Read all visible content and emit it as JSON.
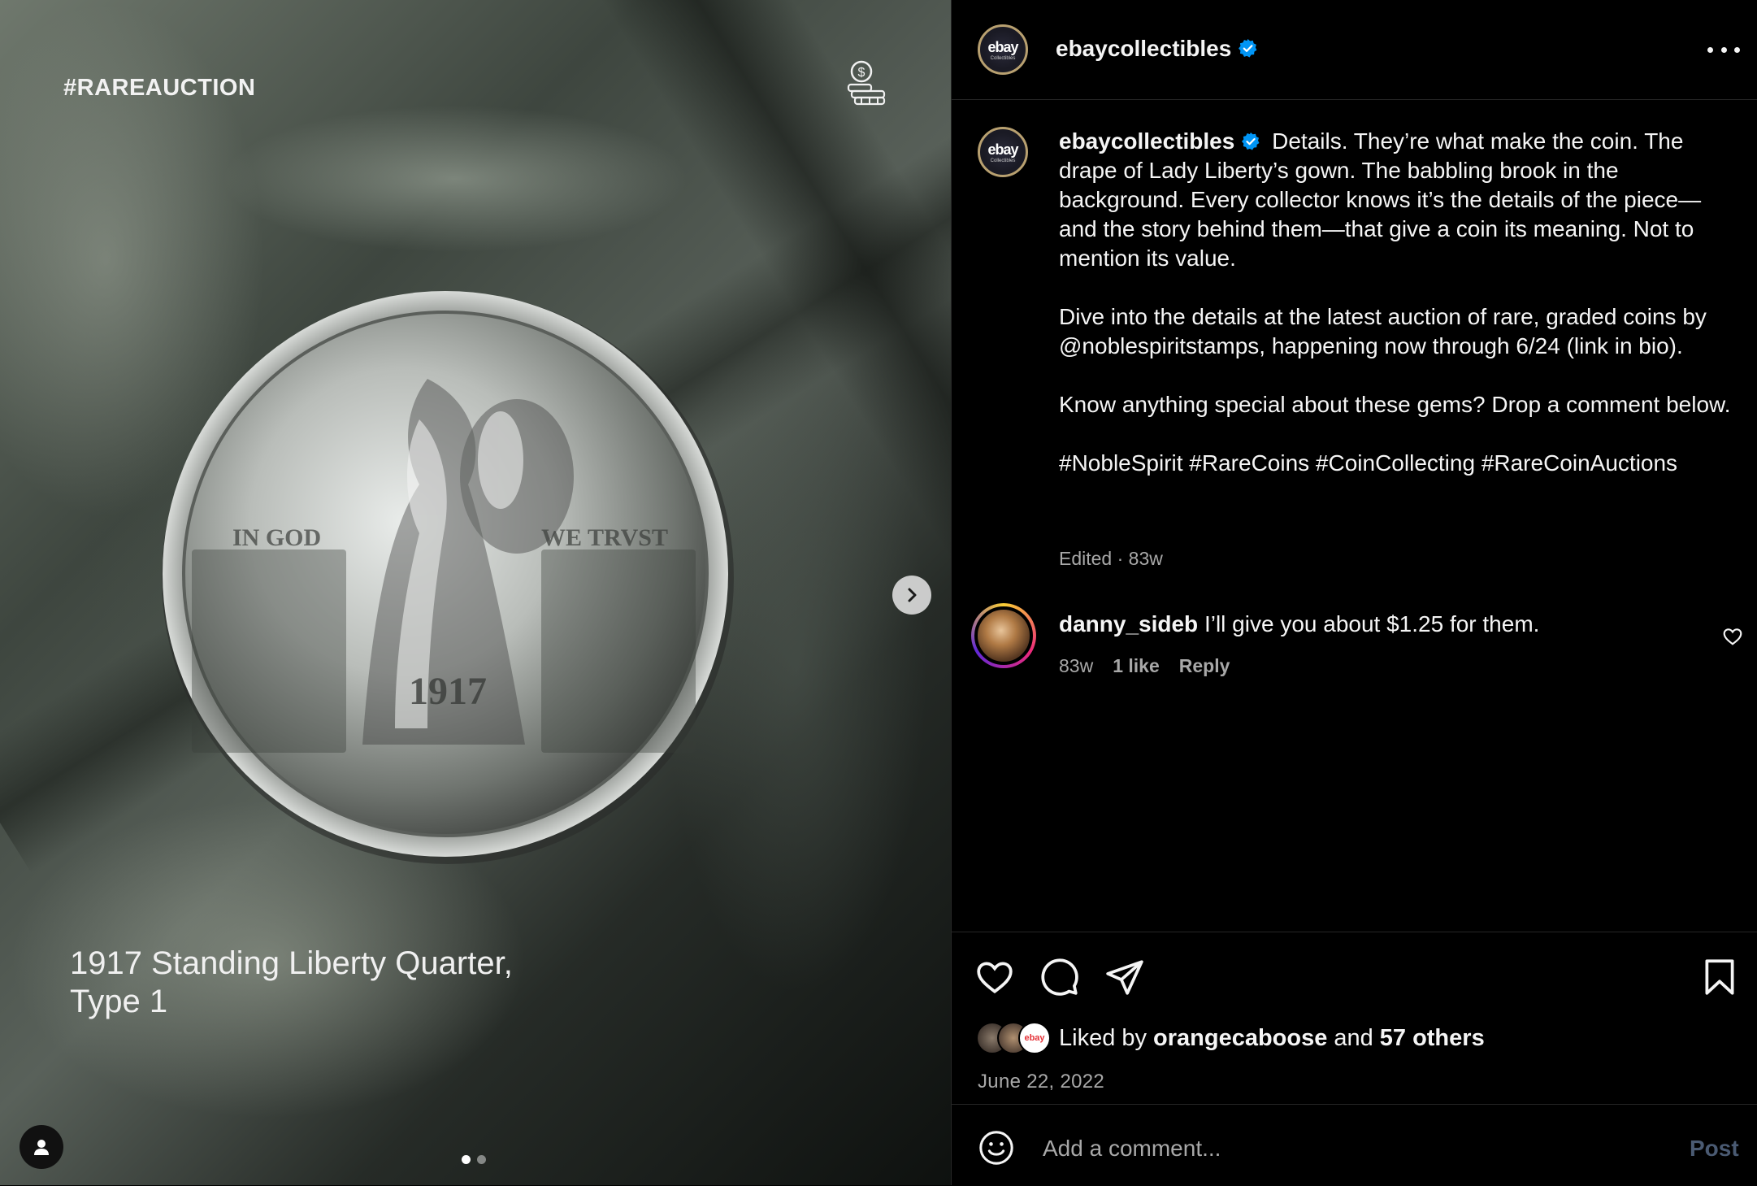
{
  "post_media": {
    "hashtag_overlay": "#RAREAUCTION",
    "caption_overlay": "1917 Standing Liberty Quarter, Type 1",
    "icons": [
      "coins-icon",
      "chevron-right-icon",
      "user-tag-icon"
    ],
    "carousel": {
      "total": 2,
      "current": 1
    }
  },
  "header": {
    "username": "ebaycollectibles",
    "verified": true,
    "avatar_logo": "ebay",
    "avatar_subtext": "Collectibles"
  },
  "caption": {
    "username": "ebaycollectibles",
    "para1": "Details. They’re what make the coin. The drape of Lady Liberty’s gown. The babbling brook in the background. Every collector knows it’s the details of the piece—and the story behind them—that give a coin its meaning. Not to mention its value.",
    "para2": "Dive into the details at the latest auction of rare, graded coins by @noblespiritstamps, happening now through 6/24 (link in bio).",
    "para3": "Know anything special about these gems? Drop a comment below.",
    "para4": "#NobleSpirit #RareCoins #CoinCollecting #RareCoinAuctions",
    "meta": "Edited · 83w"
  },
  "comment": {
    "username": "danny_sideb",
    "text": "I’ll give you about $1.25 for them.",
    "age": "83w",
    "likes": "1 like",
    "reply": "Reply"
  },
  "likes": {
    "prefix": "Liked by",
    "user": "orangecaboose",
    "and": "and",
    "others": "57 others",
    "mini_avatar_label": "ebay"
  },
  "date": "June 22, 2022",
  "comment_input": {
    "placeholder": "Add a comment...",
    "post_label": "Post"
  },
  "colors": {
    "background": "#000000",
    "verified": "#0095f6",
    "muted_text": "#a8a8a8",
    "post_disabled": "#4a5a72"
  }
}
